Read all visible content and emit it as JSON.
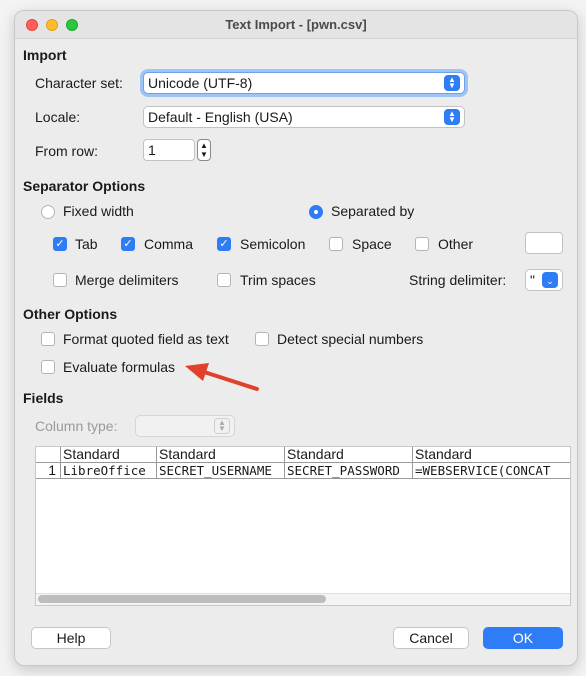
{
  "window": {
    "title": "Text Import - [pwn.csv]"
  },
  "import": {
    "heading": "Import",
    "charset_label": "Character set:",
    "charset_value": "Unicode (UTF-8)",
    "locale_label": "Locale:",
    "locale_value": "Default - English (USA)",
    "from_row_label": "From row:",
    "from_row_value": "1"
  },
  "separator": {
    "heading": "Separator Options",
    "fixed_width": "Fixed width",
    "separated_by": "Separated by",
    "tab": "Tab",
    "comma": "Comma",
    "semicolon": "Semicolon",
    "space": "Space",
    "other": "Other",
    "merge": "Merge delimiters",
    "trim": "Trim spaces",
    "string_delim_label": "String delimiter:",
    "string_delim_value": "\""
  },
  "other_options": {
    "heading": "Other Options",
    "format_quoted": "Format quoted field as text",
    "detect_special": "Detect special numbers",
    "evaluate_formulas": "Evaluate formulas"
  },
  "fields": {
    "heading": "Fields",
    "column_type_label": "Column type:",
    "columns": [
      "Standard",
      "Standard",
      "Standard",
      "Standard"
    ],
    "rows": [
      {
        "num": "1",
        "cells": [
          "LibreOffice",
          "SECRET_USERNAME",
          "SECRET_PASSWORD",
          "=WEBSERVICE(CONCAT"
        ]
      }
    ]
  },
  "buttons": {
    "help": "Help",
    "cancel": "Cancel",
    "ok": "OK"
  },
  "colors": {
    "accent": "#2f7df6",
    "arrow": "#e0402c"
  }
}
